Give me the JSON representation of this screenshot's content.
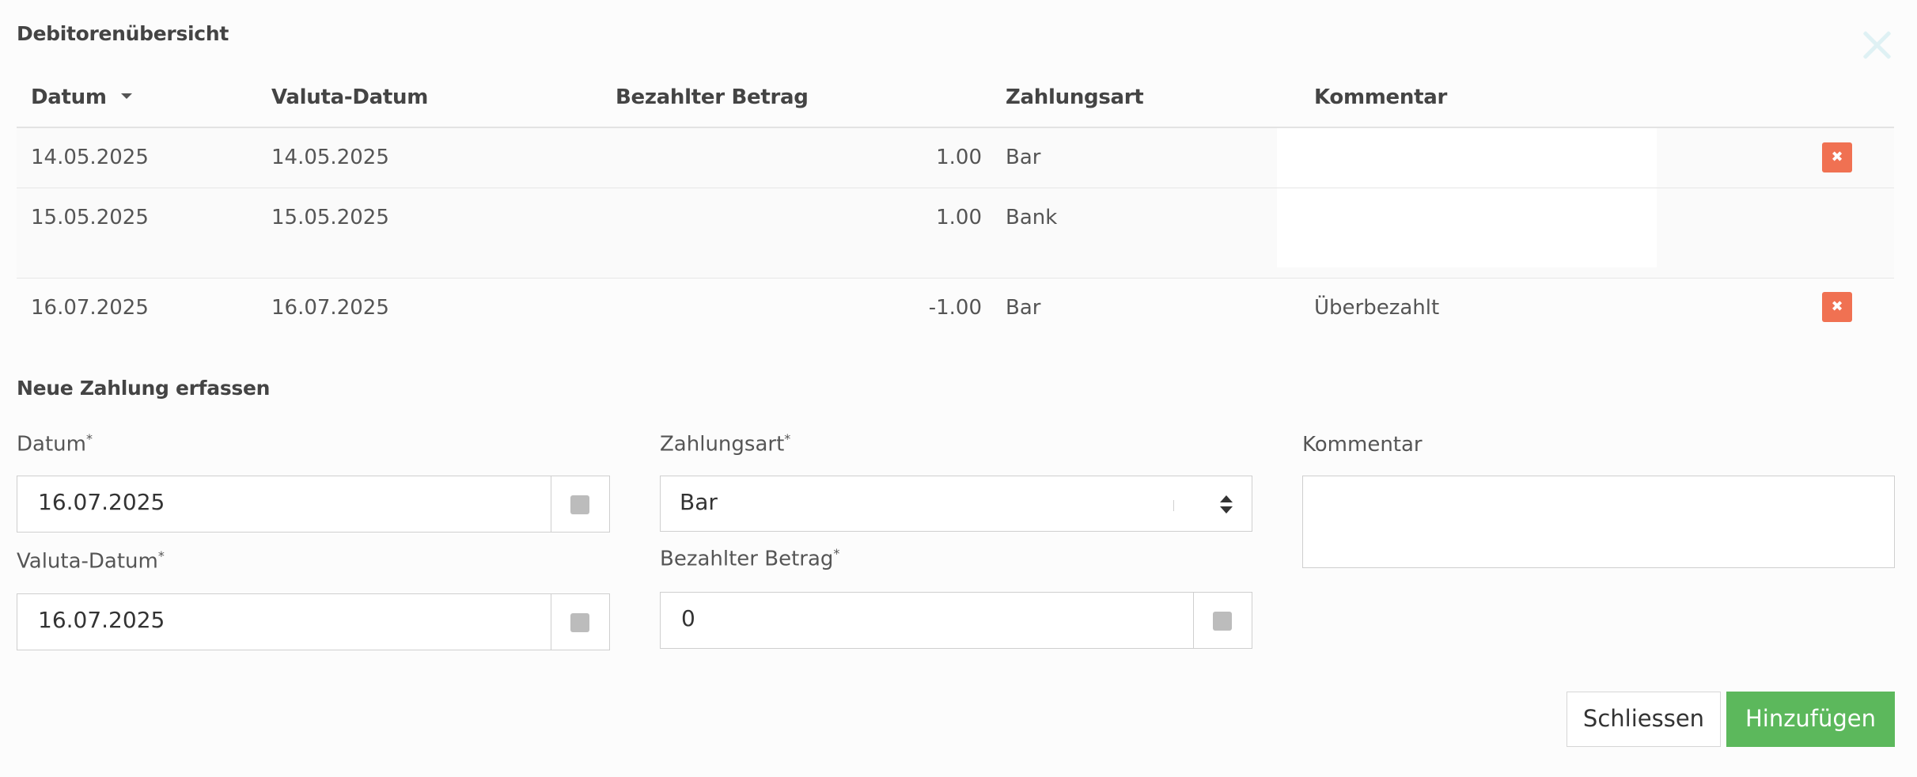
{
  "dialog": {
    "title": "Debitorenübersicht"
  },
  "table": {
    "columns": [
      "Datum",
      "Valuta-Datum",
      "Bezahlter Betrag",
      "Zahlungsart",
      "Kommentar"
    ],
    "rows": [
      {
        "datum": "14.05.2025",
        "valuta": "14.05.2025",
        "betrag": "1.00",
        "zahlungsart": "Bar",
        "kommentar": "",
        "deletable": true
      },
      {
        "datum": "15.05.2025",
        "valuta": "15.05.2025",
        "betrag": "1.00",
        "zahlungsart": "Bank",
        "kommentar": "",
        "deletable": false
      },
      {
        "datum": "16.07.2025",
        "valuta": "16.07.2025",
        "betrag": "-1.00",
        "zahlungsart": "Bar",
        "kommentar": "Überbezahlt",
        "deletable": true
      }
    ],
    "delete_glyph": "✖"
  },
  "form": {
    "section_title": "Neue Zahlung erfassen",
    "required_mark": "*",
    "datum": {
      "label": "Datum",
      "value": "16.07.2025"
    },
    "valuta": {
      "label": "Valuta-Datum",
      "value": "16.07.2025"
    },
    "zahlungsart": {
      "label": "Zahlungsart",
      "value": "Bar"
    },
    "betrag": {
      "label": "Bezahlter Betrag",
      "value": "0"
    },
    "kommentar": {
      "label": "Kommentar",
      "value": ""
    }
  },
  "buttons": {
    "close_label": "Schliessen",
    "add_label": "Hinzufügen"
  },
  "colors": {
    "delete": "#f07152",
    "primary": "#5cb85c",
    "close_x": "#dff1f4"
  }
}
